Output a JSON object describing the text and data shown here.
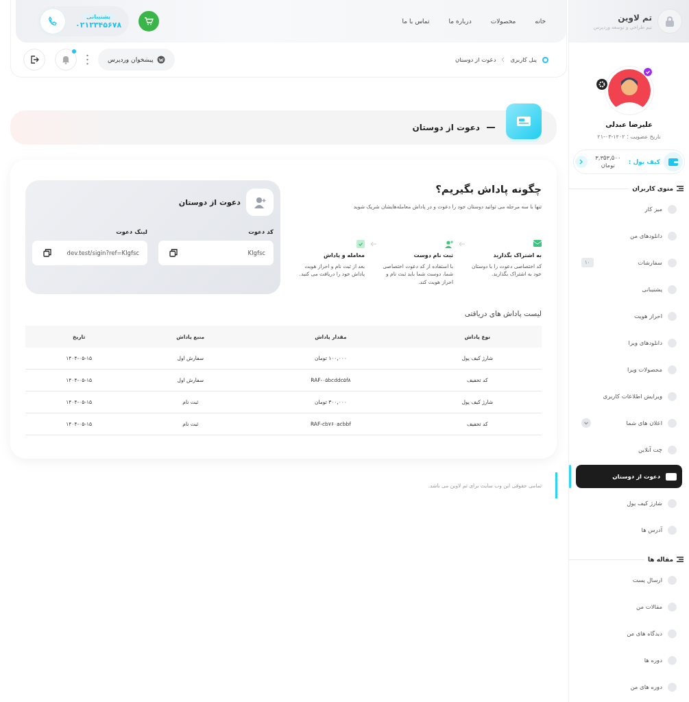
{
  "brand": {
    "name": "تم لاوین",
    "tagline": "تیم طراحی و توسعه وردپرس"
  },
  "nav": [
    "خانه",
    "محصولات",
    "درباره ما",
    "تماس با ما"
  ],
  "support": {
    "label": "پشتیبانی",
    "phone": "۰۲۱۲۳۴۵۶۷۸"
  },
  "breadcrumb": [
    "پنل کاربری",
    "دعوت از دوستان"
  ],
  "wp_button": "پیشخوان وردپرس",
  "notifications": {
    "unread": true
  },
  "page_title": "دعوت از دوستان",
  "how_to": {
    "title": "چگونه پاداش بگیریم؟",
    "subtitle": "تنها با سه مرحله می توانید دوستان خود را دعوت و در پاداش معامله‌هایشان شریک شوید",
    "steps": [
      {
        "kind": "share",
        "title": "به اشتراک بگذارید",
        "text": "کد اختصاصی دعوت را با دوستان خود به اشتراک بگذارید."
      },
      {
        "kind": "signup",
        "title": "ثبت نام دوست",
        "text": "با استفاده از کد دعوت اختصاصی شما، دوست شما باید ثبت نام و احراز هویت کند."
      },
      {
        "kind": "reward",
        "title": "معامله و پاداش",
        "text": "بعد از ثبت نام و احراز هویت پاداش خود را دریافت می کنید."
      }
    ]
  },
  "invite_card": {
    "title": "دعوت از دوستان",
    "fields": [
      {
        "label": "کد دعوت",
        "value": "Klgfsc"
      },
      {
        "label": "لینک دعوت",
        "value": "dev.test/sigin?ref=Klgfsc"
      }
    ]
  },
  "rewards": {
    "title": "لیست پاداش های دریافتی",
    "columns": [
      "نوع پاداش",
      "مقدار پاداش",
      "منبع پاداش",
      "تاریخ"
    ],
    "rows": [
      [
        "شارژ کیف پول",
        "۱۰۰,۰۰۰ تومان",
        "سفارش اول",
        "۱۴۰۴-۰۵-۱۵"
      ],
      [
        "کد تخفیف",
        "RAF-۰۵bcddc۵f۸",
        "سفارش اول",
        "۱۴۰۴-۰۵-۱۵"
      ],
      [
        "شارژ کیف پول",
        "۳۰۰,۰۰۰ تومان",
        "ثبت نام",
        "۱۴۰۴-۰۵-۱۵"
      ],
      [
        "کد تخفیف",
        "RAF-cb۷۶۰acbbf",
        "ثبت نام",
        "۱۴۰۴-۰۵-۱۵"
      ]
    ]
  },
  "footer": "تمامی حقوقی این وب سایت برای تم لاوین می باشد.",
  "profile": {
    "name": "علیرضا عبدلی",
    "membership": "تاریخ عضویت : ۱۴۰۲-۰۳-۲۱",
    "verified": true,
    "wallet_label": "کیف پول :",
    "wallet_amount": "۳,۳۵۳,۵۰۰",
    "wallet_unit": "تومان"
  },
  "menus": [
    {
      "title": "منوی کاربران",
      "items": [
        {
          "label": "میز کار",
          "kind": "link",
          "selected": false
        },
        {
          "label": "دانلودهای من",
          "kind": "link",
          "selected": false
        },
        {
          "label": "سفارشات",
          "kind": "link",
          "selected": false,
          "badge": "۱۰"
        },
        {
          "label": "پشتیبانی",
          "kind": "link",
          "selected": false
        },
        {
          "label": "احراز هویت",
          "kind": "link",
          "selected": false
        },
        {
          "label": "دانلودهای ویرا",
          "kind": "link",
          "selected": false
        },
        {
          "label": "محصولات ویرا",
          "kind": "link",
          "selected": false
        },
        {
          "label": "ویرایش اطلاعات کاربری",
          "kind": "link",
          "selected": false
        },
        {
          "label": "اعلان های شما",
          "kind": "dropdown",
          "selected": false
        },
        {
          "label": "چت آنلاین",
          "kind": "link",
          "selected": false
        },
        {
          "label": "دعوت از دوستان",
          "kind": "link",
          "selected": true
        },
        {
          "label": "شارژ کیف پول",
          "kind": "link",
          "selected": false
        },
        {
          "label": "آدرس ها",
          "kind": "link",
          "selected": false
        }
      ]
    },
    {
      "title": "مقاله ها",
      "items": [
        {
          "label": "ارسال پست",
          "kind": "link",
          "selected": false
        },
        {
          "label": "مقالات من",
          "kind": "link",
          "selected": false
        },
        {
          "label": "دیدگاه های من",
          "kind": "link",
          "selected": false
        },
        {
          "label": "دوره ها",
          "kind": "link",
          "selected": false
        },
        {
          "label": "دوره های من",
          "kind": "link",
          "selected": false
        }
      ]
    }
  ]
}
